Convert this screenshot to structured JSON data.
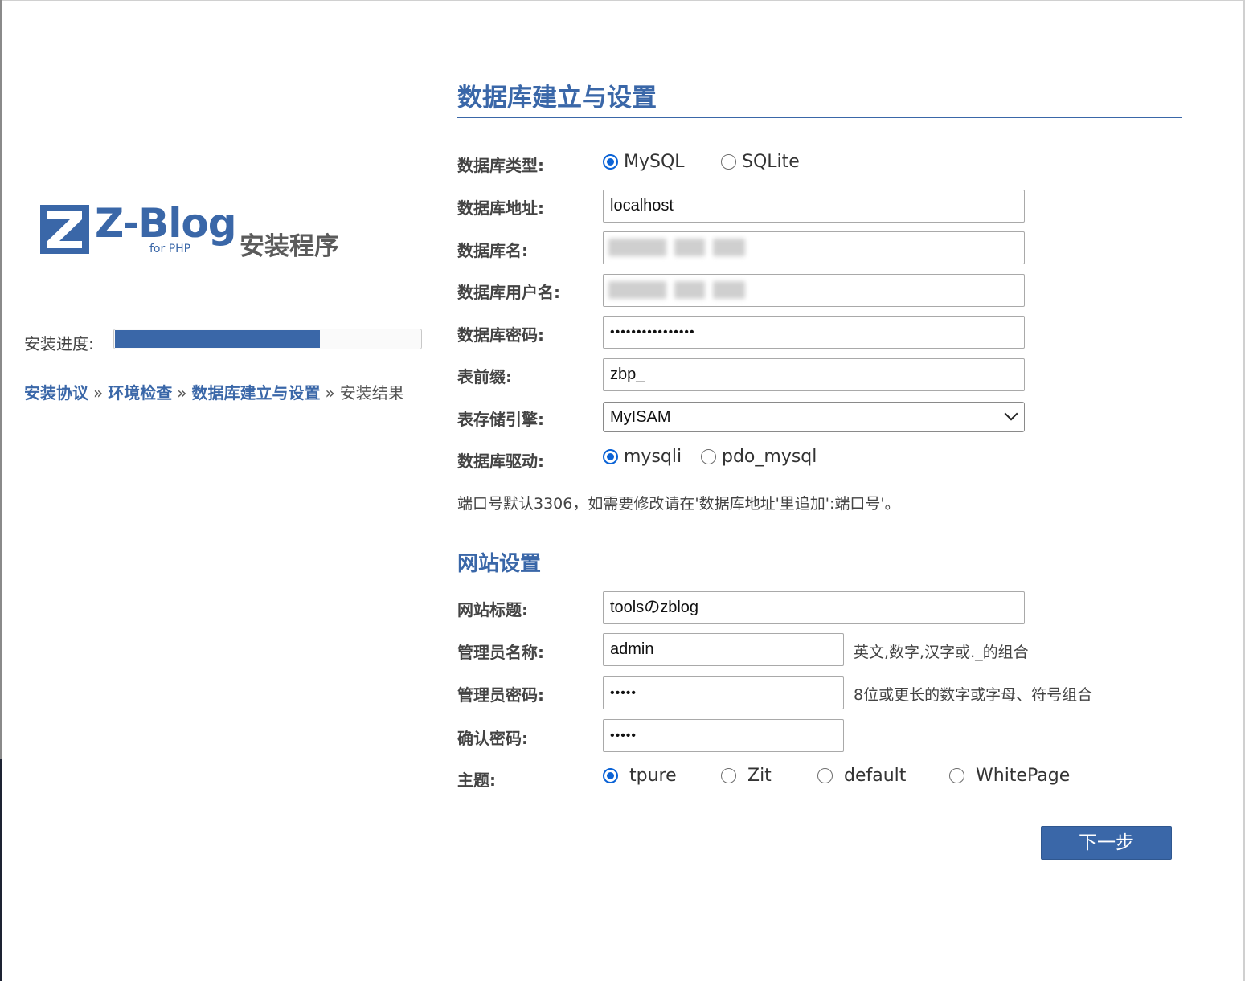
{
  "logo": {
    "mark_letter": "Z",
    "word": "Z-Blog",
    "sub": "for PHP",
    "install_text": "安装程序",
    "brand_color": "#3a67a8"
  },
  "progress": {
    "label": "安装进度:",
    "fraction": 0.67
  },
  "steps": [
    {
      "label": "安装协议",
      "done": true
    },
    {
      "label": "环境检查",
      "done": true
    },
    {
      "label": "数据库建立与设置",
      "done": true
    },
    {
      "label": "安装结果",
      "done": false
    }
  ],
  "step_separator": "»",
  "main_title": "数据库建立与设置",
  "db": {
    "type_label": "数据库类型:",
    "type_options": [
      "MySQL",
      "SQLite"
    ],
    "type_selected": "MySQL",
    "host_label": "数据库地址:",
    "host_value": "localhost",
    "name_label": "数据库名:",
    "user_label": "数据库用户名:",
    "password_label": "数据库密码:",
    "password_value": "••••••••••••••••",
    "prefix_label": "表前缀:",
    "prefix_value": "zbp_",
    "engine_label": "表存储引擎:",
    "engine_value": "MyISAM",
    "driver_label": "数据库驱动:",
    "driver_options": [
      "mysqli",
      "pdo_mysql"
    ],
    "driver_selected": "mysqli",
    "hint": "端口号默认3306，如需要修改请在'数据库地址'里追加':端口号'。"
  },
  "site": {
    "section_title": "网站设置",
    "title_label": "网站标题:",
    "title_value": "toolsのzblog",
    "admin_label": "管理员名称:",
    "admin_value": "admin",
    "admin_hint": "英文,数字,汉字或._的组合",
    "pwd_label": "管理员密码:",
    "pwd_value": "•••••",
    "pwd_hint": "8位或更长的数字或字母、符号组合",
    "confirm_label": "确认密码:",
    "confirm_value": "•••••",
    "theme_label": "主题:",
    "theme_options": [
      "tpure",
      "Zit",
      "default",
      "WhitePage"
    ],
    "theme_selected": "tpure"
  },
  "next_label": "下一步"
}
